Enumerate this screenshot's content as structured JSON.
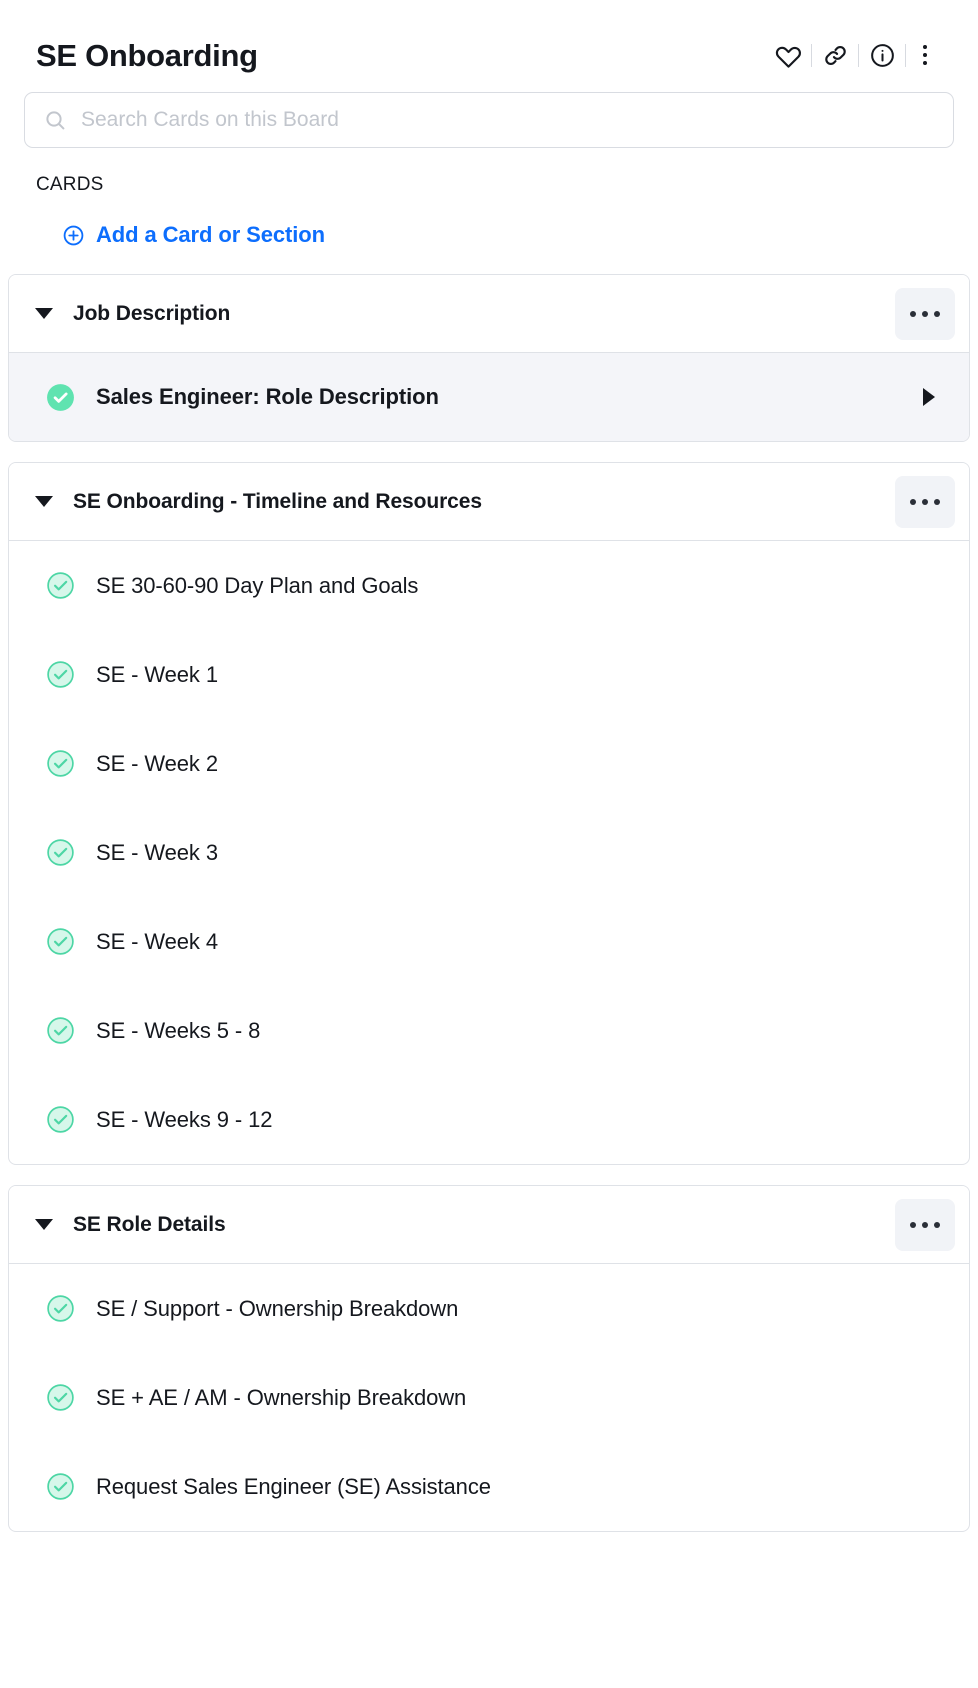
{
  "header": {
    "title": "SE Onboarding",
    "actions": [
      {
        "name": "favorite-icon",
        "label": "Favorite"
      },
      {
        "name": "link-icon",
        "label": "Copy link"
      },
      {
        "name": "info-icon",
        "label": "Board info"
      },
      {
        "name": "more-options-icon",
        "label": "More options"
      }
    ]
  },
  "search": {
    "placeholder": "Search Cards on this Board",
    "value": "",
    "icon": "search-icon"
  },
  "cards_label": "CARDS",
  "add_card": {
    "label": "Add a Card or Section",
    "icon": "plus-circle-icon",
    "color": "#0d6efd"
  },
  "colors": {
    "accent_blue": "#0d6efd",
    "check_fill_selected": "#5fe3b0",
    "check_fill_default": "#d6f7ea",
    "check_stroke": "#4dd6a5",
    "row_selected_bg": "#f4f5f9",
    "card_border": "#dfe2e7"
  },
  "sections": [
    {
      "title": "Job Description",
      "expanded": true,
      "menu_icon": "section-more-icon",
      "caret_icon": "caret-down-icon",
      "cards": [
        {
          "label": "Sales Engineer: Role Description",
          "selected": true,
          "status_icon": "check-circle-filled-icon",
          "arrow_icon": "play-arrow-icon"
        }
      ]
    },
    {
      "title": "SE Onboarding - Timeline and Resources",
      "expanded": true,
      "menu_icon": "section-more-icon",
      "caret_icon": "caret-down-icon",
      "cards": [
        {
          "label": "SE 30-60-90 Day Plan and Goals",
          "selected": false,
          "status_icon": "check-circle-icon"
        },
        {
          "label": "SE - Week 1",
          "selected": false,
          "status_icon": "check-circle-icon"
        },
        {
          "label": "SE - Week 2",
          "selected": false,
          "status_icon": "check-circle-icon"
        },
        {
          "label": "SE - Week 3",
          "selected": false,
          "status_icon": "check-circle-icon"
        },
        {
          "label": "SE - Week 4",
          "selected": false,
          "status_icon": "check-circle-icon"
        },
        {
          "label": "SE - Weeks 5 - 8",
          "selected": false,
          "status_icon": "check-circle-icon"
        },
        {
          "label": "SE - Weeks 9 - 12",
          "selected": false,
          "status_icon": "check-circle-icon"
        }
      ]
    },
    {
      "title": "SE Role Details",
      "expanded": true,
      "menu_icon": "section-more-icon",
      "caret_icon": "caret-down-icon",
      "cards": [
        {
          "label": "SE / Support - Ownership Breakdown",
          "selected": false,
          "status_icon": "check-circle-icon"
        },
        {
          "label": "SE + AE / AM - Ownership Breakdown",
          "selected": false,
          "status_icon": "check-circle-icon"
        },
        {
          "label": "Request Sales Engineer (SE) Assistance",
          "selected": false,
          "status_icon": "check-circle-icon"
        }
      ]
    }
  ]
}
